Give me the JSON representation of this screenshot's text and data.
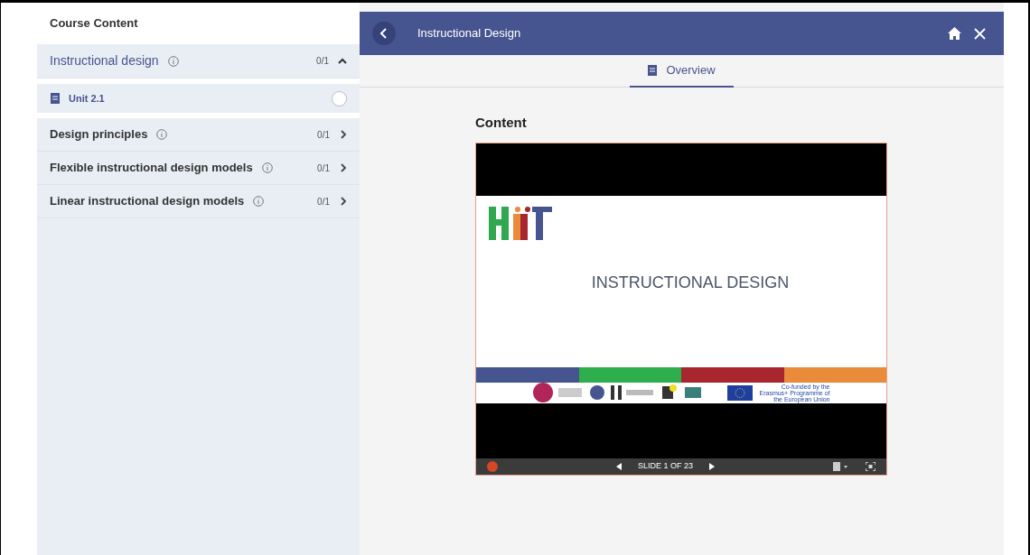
{
  "sidebar": {
    "title": "Course Content",
    "sections": [
      {
        "title": "Instructional design",
        "progress": "0/1",
        "expanded": true,
        "children": [
          {
            "title": "Unit 2.1",
            "completed": false
          }
        ]
      },
      {
        "title": "Design principles",
        "progress": "0/1",
        "expanded": false
      },
      {
        "title": "Flexible instructional design models",
        "progress": "0/1",
        "expanded": false
      },
      {
        "title": "Linear instructional design models",
        "progress": "0/1",
        "expanded": false
      }
    ]
  },
  "header": {
    "title": "Instructional Design"
  },
  "tabs": [
    {
      "label": "Overview",
      "selected": true
    }
  ],
  "content": {
    "heading": "Content",
    "slide": {
      "title": "INSTRUCTIONAL DESIGN",
      "eu_text": "Co-funded by the Erasmus+ Programme of the European Union",
      "counter": "SLIDE 1 OF 23"
    }
  }
}
